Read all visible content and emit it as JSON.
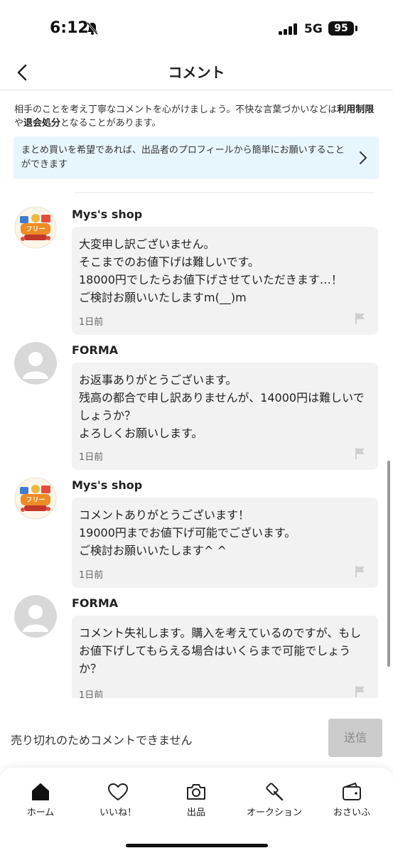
{
  "status": {
    "time": "6:12",
    "network": "5G",
    "battery": "95"
  },
  "header": {
    "title": "コメント"
  },
  "notice": {
    "part1": "相手のことを考え丁寧なコメントを心がけましょう。不快な言葉づかいなどは",
    "bold1": "利用制限",
    "part2": "や",
    "bold2": "退会処分",
    "part3": "となることがあります。"
  },
  "info_box": {
    "text": "まとめ買いを希望であれば、出品者のプロフィールから簡単にお願いすることができます"
  },
  "comments": [
    {
      "author": "Mys's shop",
      "lines": [
        "大変申し訳ございません。",
        "そこまでのお値下げは難しいです。",
        "18000円でしたらお値下げさせていただきます…！",
        "ご検討お願いいたしますm(__)m"
      ],
      "time": "1日前"
    },
    {
      "author": "FORMA",
      "lines": [
        "お返事ありがとうございます。",
        "残高の都合で申し訳ありませんが、14000円は難しいでしょうか？",
        "よろしくお願いします。"
      ],
      "time": "1日前"
    },
    {
      "author": "Mys's shop",
      "lines": [
        "コメントありがとうございます！",
        "19000円までお値下げ可能でございます。",
        "ご検討お願いいたします^ ^"
      ],
      "time": "1日前"
    },
    {
      "author": "FORMA",
      "lines": [
        "コメント失礼します。購入を考えているのですが、もしお値下げしてもらえる場合はいくらまで可能でしょうか？"
      ],
      "time": "1日前"
    }
  ],
  "compose": {
    "disabled_text": "売り切れのためコメントできません",
    "send_label": "送信"
  },
  "tabs": [
    {
      "label": "ホーム",
      "icon": "home-icon"
    },
    {
      "label": "いいね！",
      "icon": "heart-icon"
    },
    {
      "label": "出品",
      "icon": "camera-icon"
    },
    {
      "label": "オークション",
      "icon": "gavel-icon"
    },
    {
      "label": "おさいふ",
      "icon": "wallet-icon"
    }
  ],
  "colors": {
    "info_bg": "#e7f6fc",
    "bubble_bg": "#f2f2f2",
    "send_disabled": "#cccccc"
  }
}
